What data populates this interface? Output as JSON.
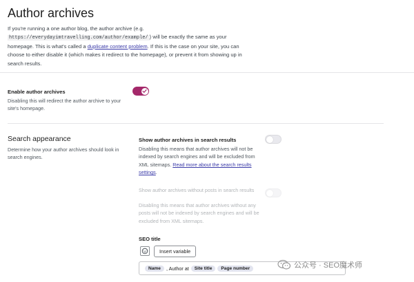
{
  "header": {
    "title": "Author archives"
  },
  "intro": {
    "text_1": "If you're running a one author blog, the author archive (e.g. ",
    "code_example": "https://everydayimtravelling.com/author/example/",
    "text_2": ") will be exactly the same as your homepage. This is what's called a ",
    "link_label": "duplicate content problem",
    "text_3": ". If this is the case on your site, you can choose to either disable it (which makes it redirect to the homepage), or prevent it from showing up in search results."
  },
  "enable_section": {
    "label": "Enable author archives",
    "description": "Disabling this will redirect the author archive to your site's homepage.",
    "toggle_on": true,
    "accent_color": "#a4286a"
  },
  "search_appearance": {
    "title": "Search appearance",
    "description": "Determine how your author archives should look in search engines.",
    "show_in_results": {
      "label": "Show author archives in search results",
      "description": "Disabling this means that author archives will not be indexed by search engines and will be excluded from XML sitemaps. ",
      "link_label": "Read more about the search results settings",
      "link_suffix": ".",
      "toggle_on": false
    },
    "show_without_posts": {
      "label": "Show author archives without posts in search results",
      "description": "Disabling this means that author archives without any posts will not be indexed by search engines and will be excluded from XML sitemaps.",
      "toggle_on": false,
      "disabled": true
    },
    "seo_title": {
      "label": "SEO title",
      "insert_variable_label": "Insert variable",
      "emoji_icon": "smiley-icon",
      "template_parts": [
        {
          "type": "pill",
          "text": "Name"
        },
        {
          "type": "text",
          "text": ", Author at"
        },
        {
          "type": "pill",
          "text": "Site title"
        },
        {
          "type": "pill",
          "text": "Page number"
        }
      ]
    }
  },
  "watermark": {
    "text": "公众号 · SEO魔术师"
  }
}
